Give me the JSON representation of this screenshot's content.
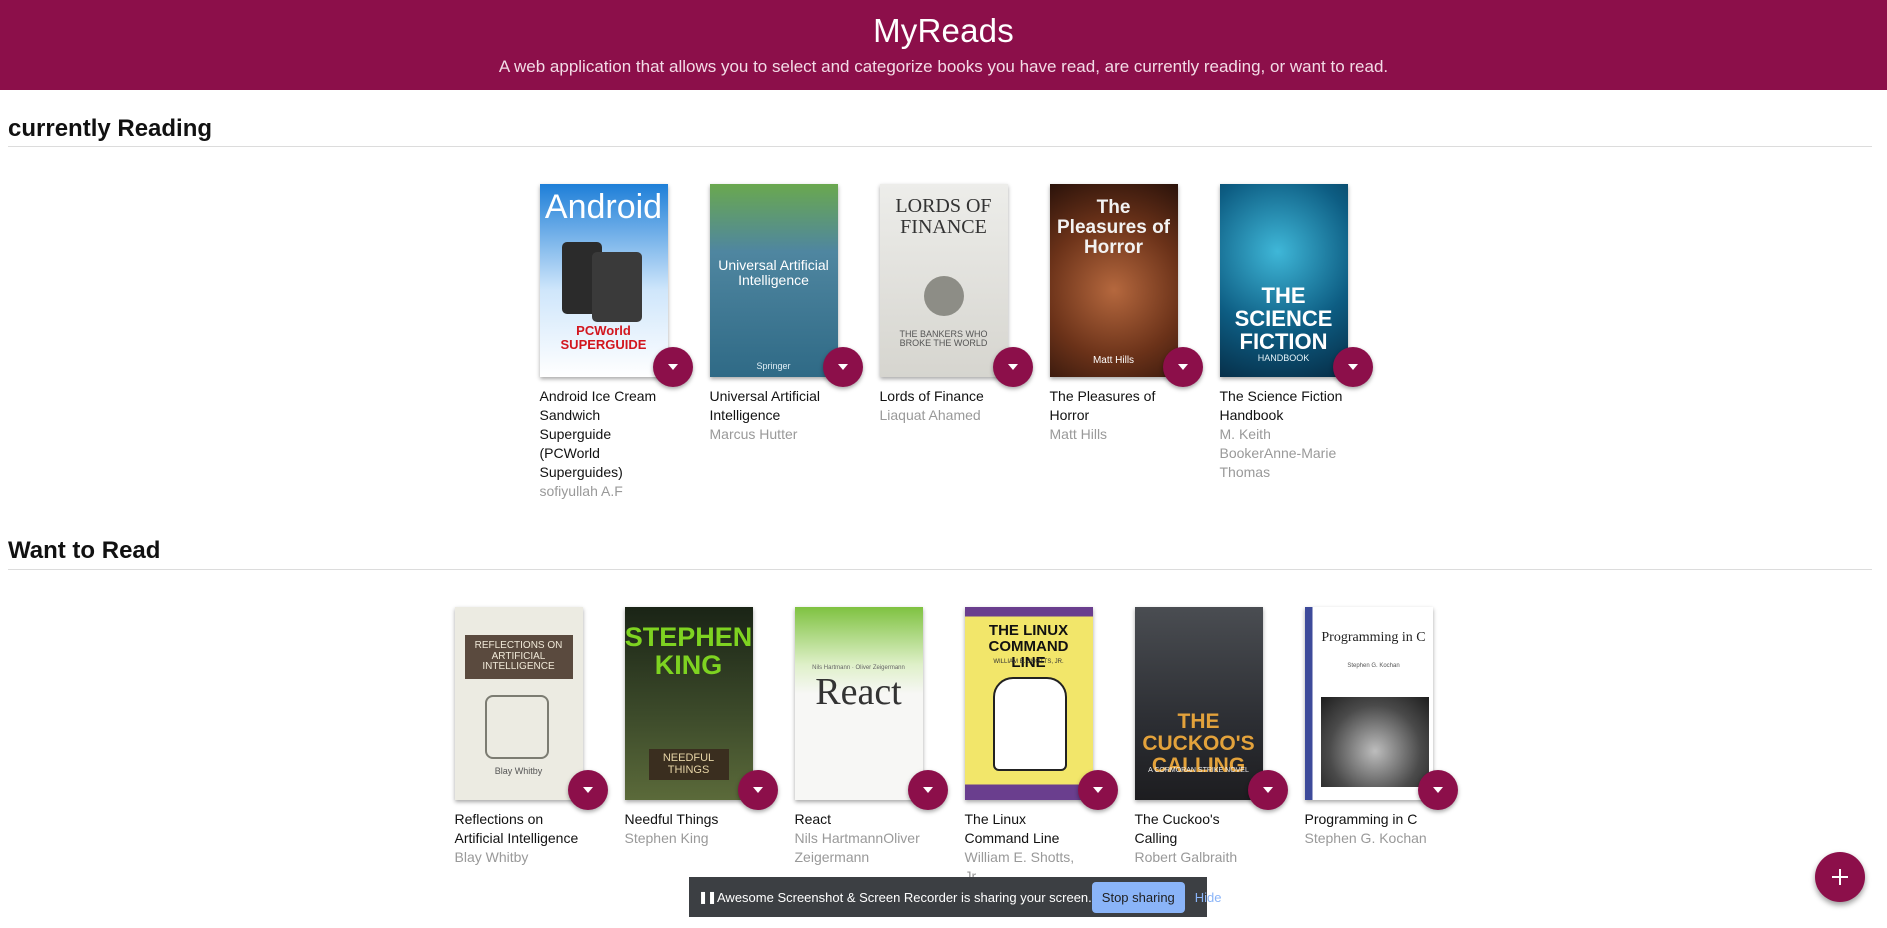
{
  "header": {
    "title": "MyReads",
    "subtitle": "A web application that allows you to select and categorize books you have read, are currently reading, or want to read."
  },
  "shelves": [
    {
      "title": "currently Reading",
      "books": [
        {
          "title": "Android Ice Cream Sandwich Superguide (PCWorld Superguides)",
          "authors": "sofiyullah A.F",
          "cover_text": "Android",
          "cover_sub": "PCWorld SUPERGUIDE"
        },
        {
          "title": "Universal Artificial Intelligence",
          "authors": "Marcus Hutter",
          "cover_text": "Universal Artificial Intelligence",
          "cover_sub": "Springer"
        },
        {
          "title": "Lords of Finance",
          "authors": "Liaquat Ahamed",
          "cover_text": "LORDS OF FINANCE",
          "cover_sub": "THE BANKERS WHO BROKE THE WORLD"
        },
        {
          "title": "The Pleasures of Horror",
          "authors": "Matt Hills",
          "cover_text": "The Pleasures of Horror",
          "cover_sub": "Matt Hills"
        },
        {
          "title": "The Science Fiction Handbook",
          "authors": "M. Keith BookerAnne-Marie Thomas",
          "cover_text": "THE SCIENCE FICTION",
          "cover_sub": "HANDBOOK"
        }
      ]
    },
    {
      "title": "Want to Read",
      "books": [
        {
          "title": "Reflections on Artificial Intelligence",
          "authors": "Blay Whitby",
          "cover_text": "REFLECTIONS ON ARTIFICIAL INTELLIGENCE",
          "cover_sub": "Blay Whitby"
        },
        {
          "title": "Needful Things",
          "authors": "Stephen King",
          "cover_text": "STEPHEN KING",
          "cover_sub": "NEEDFUL THINGS"
        },
        {
          "title": "React",
          "authors": "Nils HartmannOliver Zeigermann",
          "cover_text": "React",
          "cover_sub": "Nils Hartmann · Oliver Zeigermann"
        },
        {
          "title": "The Linux Command Line",
          "authors": "William E. Shotts, Jr.",
          "cover_text": "THE LINUX COMMAND LINE",
          "cover_sub": "WILLIAM E. SHOTTS, JR."
        },
        {
          "title": "The Cuckoo's Calling",
          "authors": "Robert Galbraith",
          "cover_text": "THE CUCKOO'S CALLING",
          "cover_sub": "A CORMORAN STRIKE NOVEL"
        },
        {
          "title": "Programming in C",
          "authors": "Stephen G. Kochan",
          "cover_text": "Programming in C",
          "cover_sub": "Stephen G. Kochan"
        }
      ]
    }
  ],
  "share_bar": {
    "message": "Awesome Screenshot & Screen Recorder is sharing your screen.",
    "stop_label": "Stop sharing",
    "hide_label": "Hide"
  },
  "colors": {
    "brand": "#8c0f4a",
    "share_bar_bg": "#3c3f43",
    "stop_button": "#8ab4f8"
  },
  "icons": {
    "shelf_changer": "chevron-down-icon",
    "add": "plus-icon",
    "pause": "pause-icon"
  }
}
